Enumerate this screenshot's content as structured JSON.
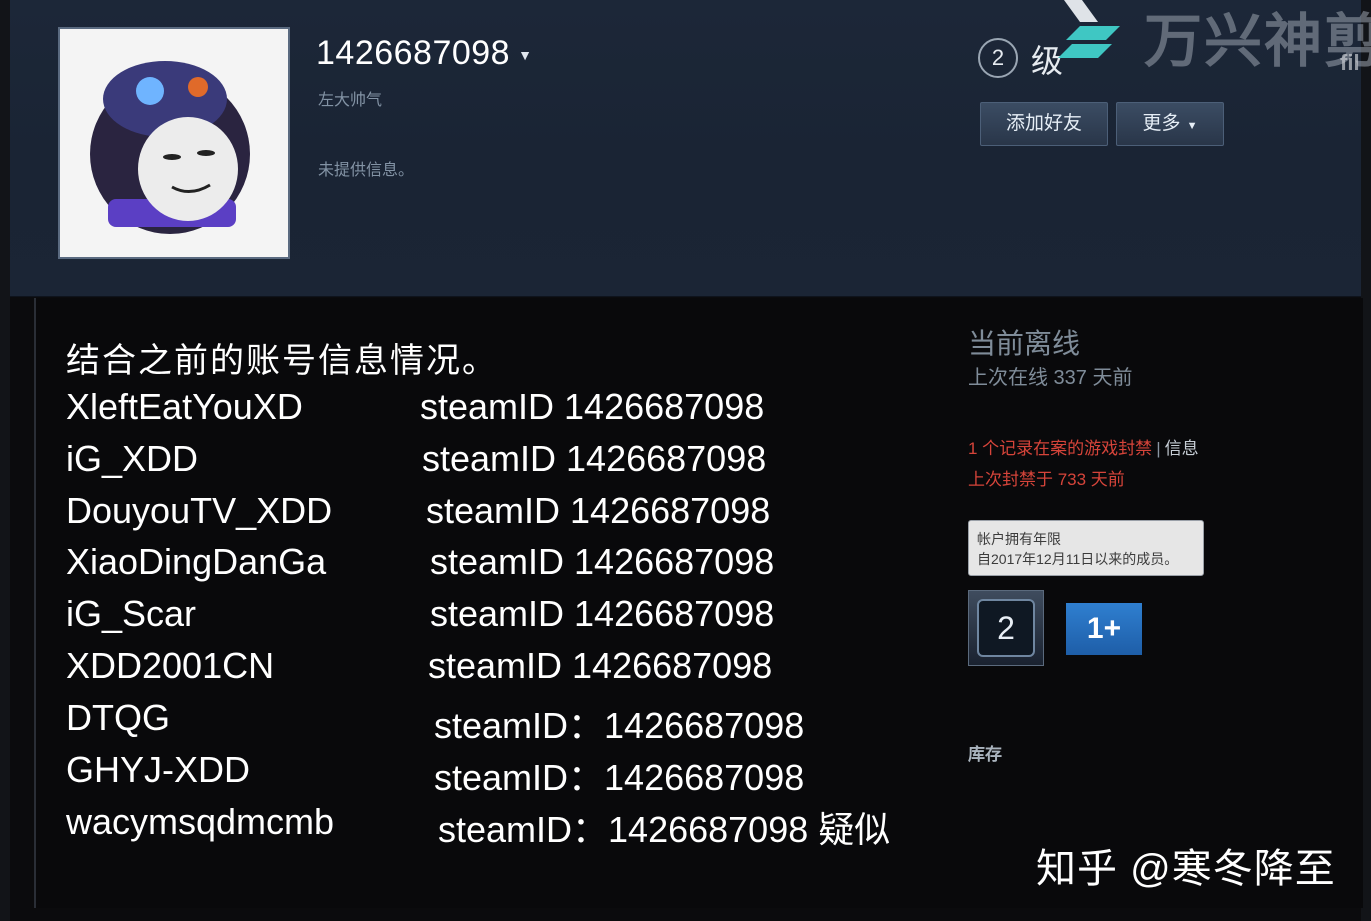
{
  "profile": {
    "persona_name": "1426687098",
    "real_name": "左大帅气",
    "summary": "未提供信息。",
    "level_number": "2",
    "level_label": "级",
    "add_friend_label": "添加好友",
    "more_label": "更多"
  },
  "watermark": {
    "text": "万兴神剪",
    "sub": "fil"
  },
  "caption": {
    "title": "结合之前的账号信息情况。",
    "rows": [
      {
        "name": "XleftEatYouXD",
        "id": "steamID 1426687098"
      },
      {
        "name": "iG_XDD",
        "id": "steamID 1426687098"
      },
      {
        "name": "DouyouTV_XDD",
        "id": "steamID 1426687098"
      },
      {
        "name": "XiaoDingDanGa",
        "id": "steamID 1426687098"
      },
      {
        "name": "iG_Scar",
        "id": "steamID 1426687098"
      },
      {
        "name": "XDD2001CN",
        "id": "steamID 1426687098"
      },
      {
        "name": "DTQG",
        "id": "steamID：1426687098"
      },
      {
        "name": "GHYJ-XDD",
        "id": "steamID：1426687098"
      },
      {
        "name": "wacymsqdmcmb",
        "id": "steamID：1426687098 疑似"
      }
    ]
  },
  "sidebar": {
    "status": "当前离线",
    "last_online": "上次在线 337 天前",
    "ban_text": "1 个记录在案的游戏封禁",
    "ban_separator": "|",
    "ban_info_link": "信息",
    "ban_ago": "上次封禁于 733 天前",
    "years_title": "帐户拥有年限",
    "years_detail": "自2017年12月11日以来的成员。",
    "badge_level": "2",
    "badge_years": "1+",
    "inventory_label": "库存"
  },
  "credit": "知乎 @寒冬降至",
  "colors": {
    "header_bg": "#1b2535",
    "ban_red": "#d6443a",
    "accent_blue": "#2f7fd0"
  },
  "icons": [
    "avatar-image",
    "dropdown-caret-icon",
    "watermark-logo-icon",
    "level-badge-icon",
    "years-of-service-badge-icon"
  ]
}
